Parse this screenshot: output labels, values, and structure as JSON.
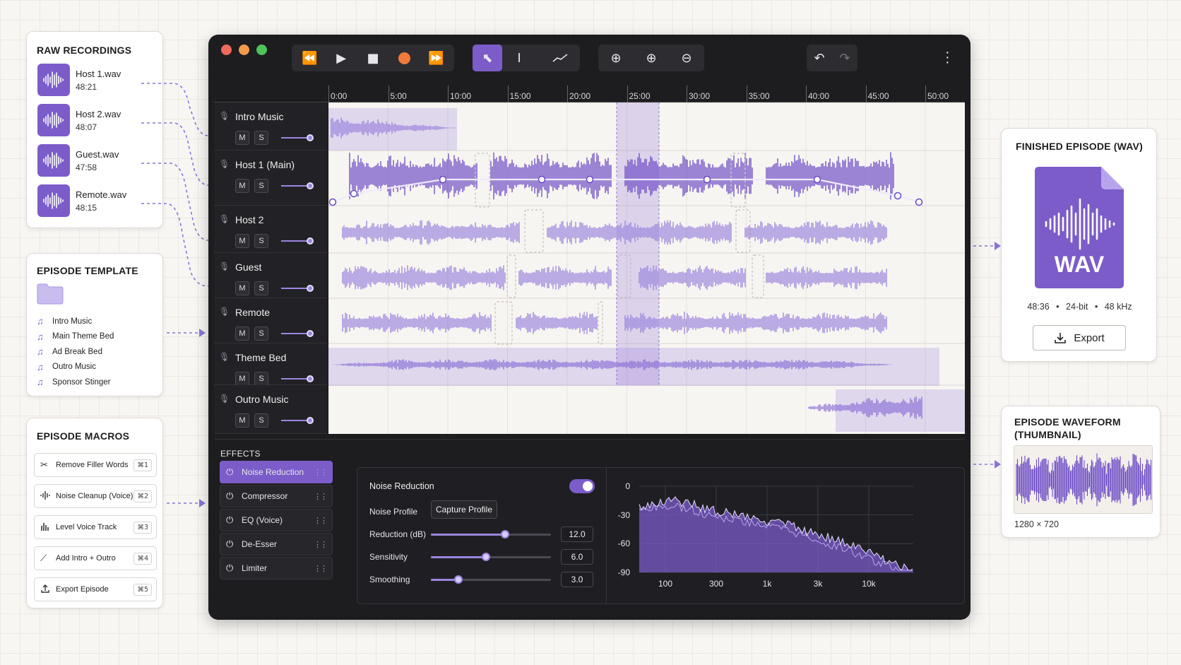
{
  "raw_recordings": {
    "title": "RAW RECORDINGS",
    "items": [
      {
        "name": "Host 1.wav",
        "duration": "48:21"
      },
      {
        "name": "Host 2.wav",
        "duration": "48:07"
      },
      {
        "name": "Guest.wav",
        "duration": "47:58"
      },
      {
        "name": "Remote.wav",
        "duration": "48:15"
      }
    ]
  },
  "episode_template": {
    "title": "EPISODE TEMPLATE",
    "items": [
      "Intro Music",
      "Main Theme Bed",
      "Ad Break Bed",
      "Outro Music",
      "Sponsor Stinger"
    ]
  },
  "episode_macros": {
    "title": "EPISODE MACROS",
    "items": [
      {
        "label": "Remove Filler Words",
        "shortcut": "⌘1",
        "icon": "scissors-icon"
      },
      {
        "label": "Noise Cleanup (Voice)",
        "shortcut": "⌘2",
        "icon": "waveform-icon"
      },
      {
        "label": "Level Voice Track",
        "shortcut": "⌘3",
        "icon": "bars-icon"
      },
      {
        "label": "Add Intro + Outro",
        "shortcut": "⌘4",
        "icon": "magic-wand-icon"
      },
      {
        "label": "Export Episode",
        "shortcut": "⌘5",
        "icon": "upload-icon"
      }
    ]
  },
  "timeline": {
    "ruler": [
      "0:00",
      "5:00",
      "10:00",
      "15:00",
      "20:00",
      "25:00",
      "30:00",
      "35:00",
      "40:00",
      "45:00",
      "50:00"
    ],
    "tracks": [
      {
        "name": "Intro Music",
        "mute": "M",
        "solo": "S",
        "volume": 0.9
      },
      {
        "name": "Host 1 (Main)",
        "mute": "M",
        "solo": "S",
        "volume": 0.9
      },
      {
        "name": "Host 2",
        "mute": "M",
        "solo": "S",
        "volume": 0.9
      },
      {
        "name": "Guest",
        "mute": "M",
        "solo": "S",
        "volume": 0.9
      },
      {
        "name": "Remote",
        "mute": "M",
        "solo": "S",
        "volume": 0.9
      },
      {
        "name": "Theme Bed",
        "mute": "M",
        "solo": "S",
        "volume": 0.9
      },
      {
        "name": "Outro Music",
        "mute": "M",
        "solo": "S",
        "volume": 0.9
      }
    ]
  },
  "effects": {
    "title": "EFFECTS",
    "items": [
      "Noise Reduction",
      "Compressor",
      "EQ (Voice)",
      "De-Esser",
      "Limiter"
    ],
    "active": "Noise Reduction"
  },
  "noise_reduction": {
    "title": "Noise Reduction",
    "enabled": true,
    "profile_label": "Noise Profile",
    "profile_button": "Capture Profile",
    "params": [
      {
        "label": "Reduction (dB)",
        "value": "12.0",
        "fraction": 0.62
      },
      {
        "label": "Sensitivity",
        "value": "6.0",
        "fraction": 0.46
      },
      {
        "label": "Smoothing",
        "value": "3.0",
        "fraction": 0.23
      }
    ]
  },
  "spectrum": {
    "y_labels": [
      "0",
      "-30",
      "-60",
      "-90"
    ],
    "x_labels": [
      "100",
      "300",
      "1k",
      "3k",
      "10k"
    ]
  },
  "finished_episode": {
    "title": "FINISHED EPISODE (WAV)",
    "file_label": "WAV",
    "duration": "48:36",
    "bit_depth": "24-bit",
    "sample_rate": "48 kHz",
    "separator": "•",
    "export_label": "Export"
  },
  "thumbnail": {
    "title_line1": "EPISODE WAVEFORM",
    "title_line2": "(THUMBNAIL)",
    "size": "1280 × 720"
  },
  "colors": {
    "accent": "#7b5cc9",
    "waveform": "#8b6fd6",
    "app_bg": "#1d1d20"
  }
}
